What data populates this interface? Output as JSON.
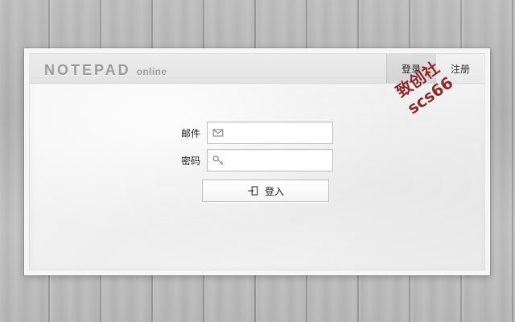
{
  "header": {
    "brand_main": "NOTEPAD",
    "brand_sub": "online",
    "actions": [
      {
        "label": "登录"
      },
      {
        "label": "注册"
      }
    ],
    "watermark": "致创社scs66"
  },
  "login_form": {
    "email_label": "邮件",
    "email_value": "",
    "email_placeholder": "",
    "password_label": "密码",
    "password_value": "",
    "password_placeholder": "",
    "submit_label": "登入"
  },
  "icons": {
    "email": "mail-icon",
    "password": "key-icon",
    "submit": "login-icon"
  }
}
